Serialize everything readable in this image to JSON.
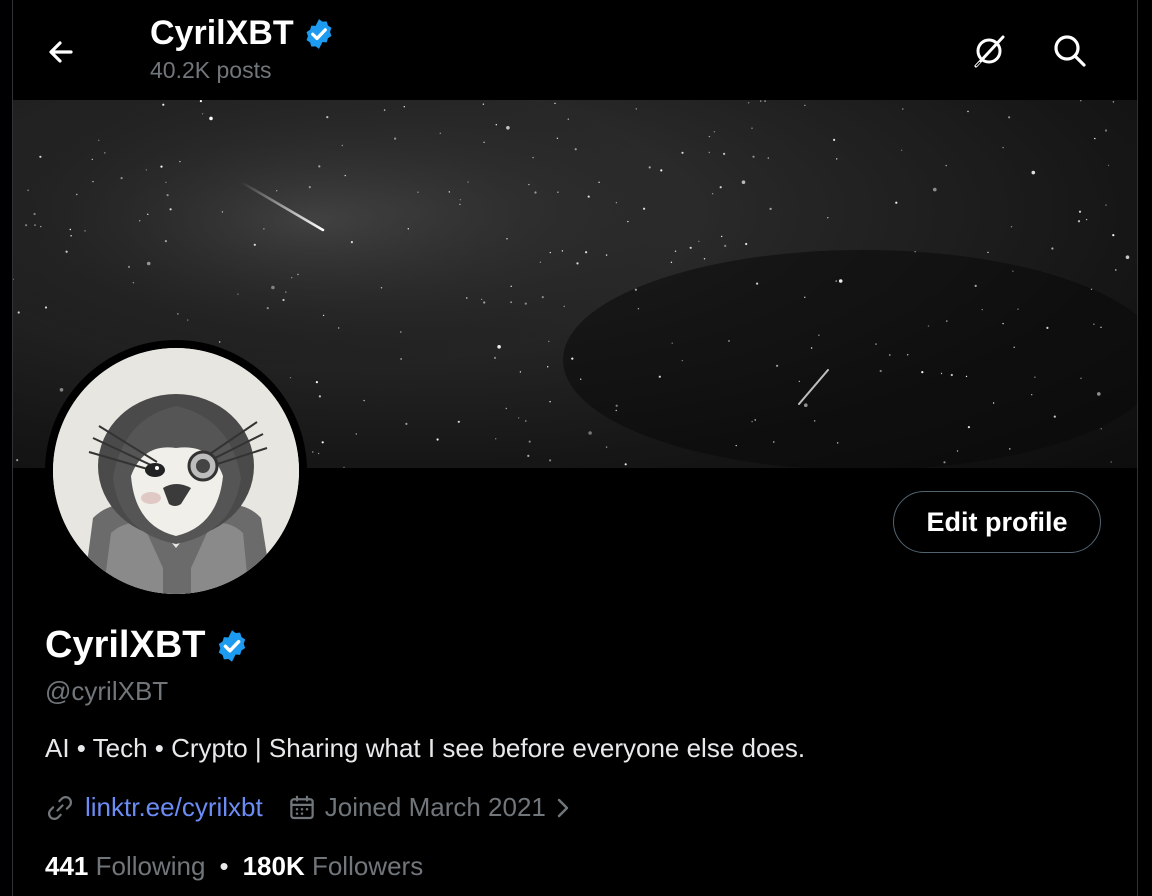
{
  "header": {
    "title": "CyrilXBT",
    "posts": "40.2K posts"
  },
  "profile": {
    "name": "CyrilXBT",
    "handle": "@cyrilXBT",
    "bio": "AI • Tech • Crypto | Sharing what I see before everyone else does.",
    "link": "linktr.ee/cyrilxbt",
    "joined": "Joined March 2021",
    "following_count": "441",
    "following_label": "Following",
    "followers_count": "180K",
    "followers_label": "Followers",
    "separator": "•"
  },
  "actions": {
    "edit_profile": "Edit profile"
  },
  "icons": {
    "back": "arrow-left-icon",
    "grok": "grok-icon",
    "search": "search-icon",
    "verified": "verified-badge-icon",
    "link": "link-icon",
    "calendar": "calendar-icon",
    "chevron": "chevron-right-icon"
  },
  "colors": {
    "background": "#000000",
    "verified": "#1d9bf0",
    "link": "#6b8cf5",
    "secondary_text": "#71767b"
  }
}
